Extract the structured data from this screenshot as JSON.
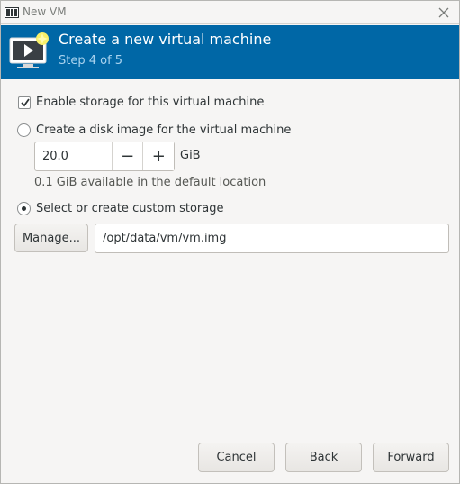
{
  "window": {
    "title": "New VM",
    "app_icon": "virt-manager-icon",
    "close_icon": "close-icon"
  },
  "header": {
    "title": "Create a new virtual machine",
    "step": "Step 4 of 5",
    "icon": "new-vm-icon",
    "background": "#0067a6"
  },
  "storage": {
    "enable_label": "Enable storage for this virtual machine",
    "enable_checked": true,
    "create_disk_label": "Create a disk image for the virtual machine",
    "create_disk_selected": false,
    "disk_size_value": "20.0",
    "decrement_label": "−",
    "increment_label": "+",
    "unit": "GiB",
    "available_hint": "0.1 GiB available in the default location",
    "custom_label": "Select or create custom storage",
    "custom_selected": true,
    "manage_label": "Manage...",
    "path_value": "/opt/data/vm/vm.img"
  },
  "footer": {
    "cancel_label": "Cancel",
    "back_label": "Back",
    "forward_label": "Forward"
  }
}
